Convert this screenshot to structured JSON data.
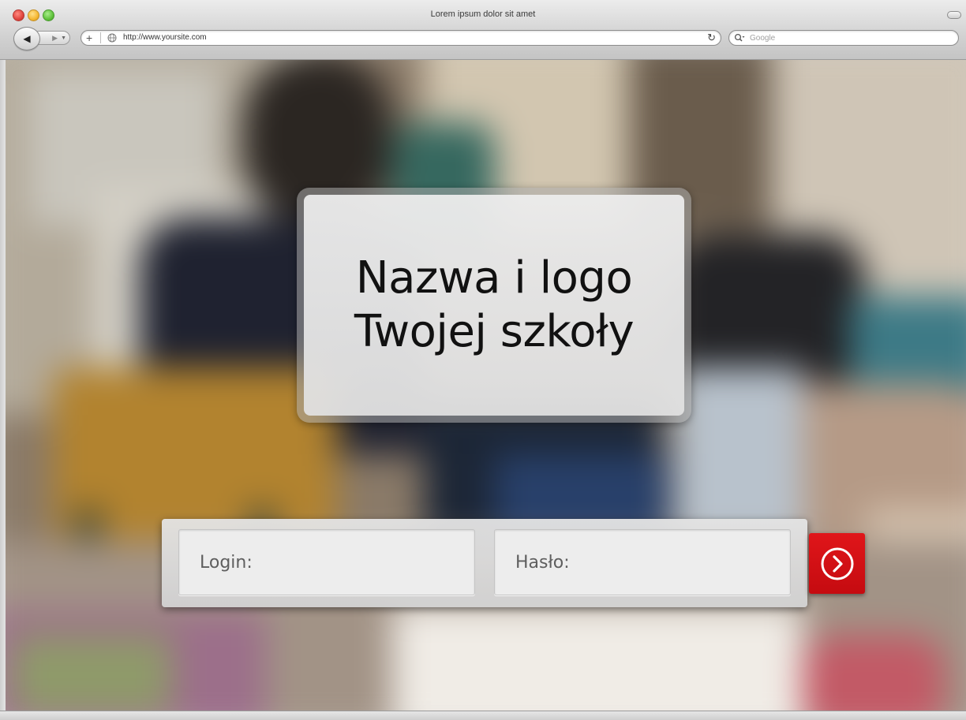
{
  "browser": {
    "window_title": "Lorem ipsum dolor sit amet",
    "address": {
      "add_label": "+",
      "url": "http://www.yoursite.com",
      "reload_icon": "reload-icon"
    },
    "search": {
      "placeholder": "Google"
    },
    "nav": {
      "back_icon": "back-arrow-icon",
      "forward_icon": "forward-arrow-icon"
    }
  },
  "page": {
    "logo_card": {
      "line1": "Nazwa i logo",
      "line2": "Twojej szkoły"
    },
    "login_form": {
      "login_placeholder": "Login:",
      "password_placeholder": "Hasło:",
      "login_value": "",
      "password_value": "",
      "submit_icon": "arrow-right-circle-icon"
    }
  },
  "colors": {
    "submit_button": "#d3101a",
    "card_background": "#e8e8e8"
  }
}
